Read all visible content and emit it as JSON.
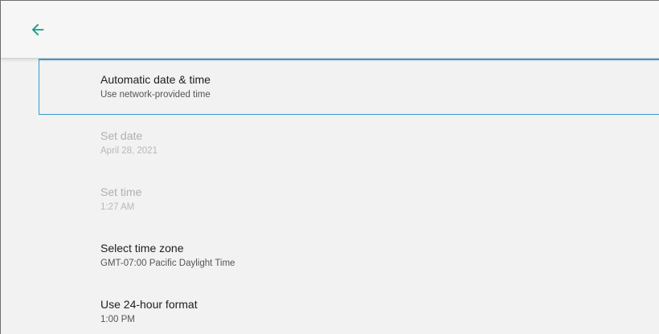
{
  "appbar": {
    "back_icon": "arrow-left-icon",
    "accent_color": "#1a9a8a"
  },
  "settings": {
    "items": [
      {
        "title": "Automatic date & time",
        "subtitle": "Use network-provided time",
        "enabled": true,
        "focused": true
      },
      {
        "title": "Set date",
        "subtitle": "April 28, 2021",
        "enabled": false
      },
      {
        "title": "Set time",
        "subtitle": "1:27 AM",
        "enabled": false
      },
      {
        "title": "Select time zone",
        "subtitle": "GMT-07:00 Pacific Daylight Time",
        "enabled": true
      },
      {
        "title": "Use 24-hour format",
        "subtitle": "1:00 PM",
        "enabled": true
      }
    ]
  },
  "colors": {
    "focus_border": "#3a9ac9",
    "background": "#f2f2f2"
  }
}
